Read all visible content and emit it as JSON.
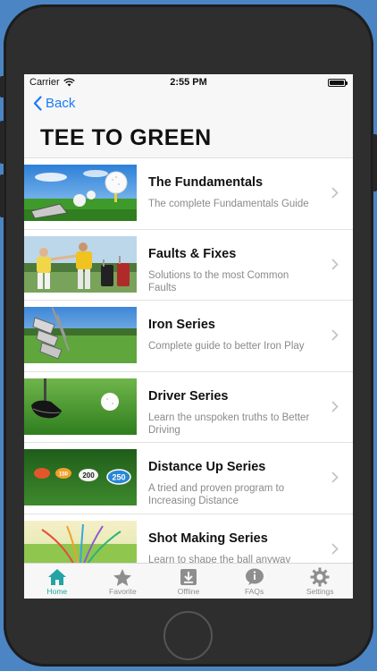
{
  "status": {
    "carrier": "Carrier",
    "time": "2:55 PM"
  },
  "nav": {
    "back_label": "Back",
    "title": "TEE TO GREEN"
  },
  "items": [
    {
      "title": "The Fundamentals",
      "subtitle": "The complete Fundamentals Guide"
    },
    {
      "title": "Faults & Fixes",
      "subtitle": "Solutions to the most Common Faults"
    },
    {
      "title": "Iron Series",
      "subtitle": "Complete guide to better Iron Play"
    },
    {
      "title": "Driver Series",
      "subtitle": "Learn the unspoken truths to Better Driving"
    },
    {
      "title": "Distance Up Series",
      "subtitle": "A tried and proven program to Increasing Distance"
    },
    {
      "title": "Shot Making Series",
      "subtitle": "Learn to shape the ball anyway"
    }
  ],
  "distance_markers": [
    "150",
    "200",
    "250"
  ],
  "tabs": [
    {
      "label": "Home",
      "icon": "home-icon"
    },
    {
      "label": "Favorite",
      "icon": "star-icon"
    },
    {
      "label": "Offline",
      "icon": "download-icon"
    },
    {
      "label": "FAQs",
      "icon": "info-icon"
    },
    {
      "label": "Settings",
      "icon": "gear-icon"
    }
  ],
  "colors": {
    "accent": "#23a3a5",
    "link": "#1a7bf2",
    "background": "#4b85c4"
  }
}
